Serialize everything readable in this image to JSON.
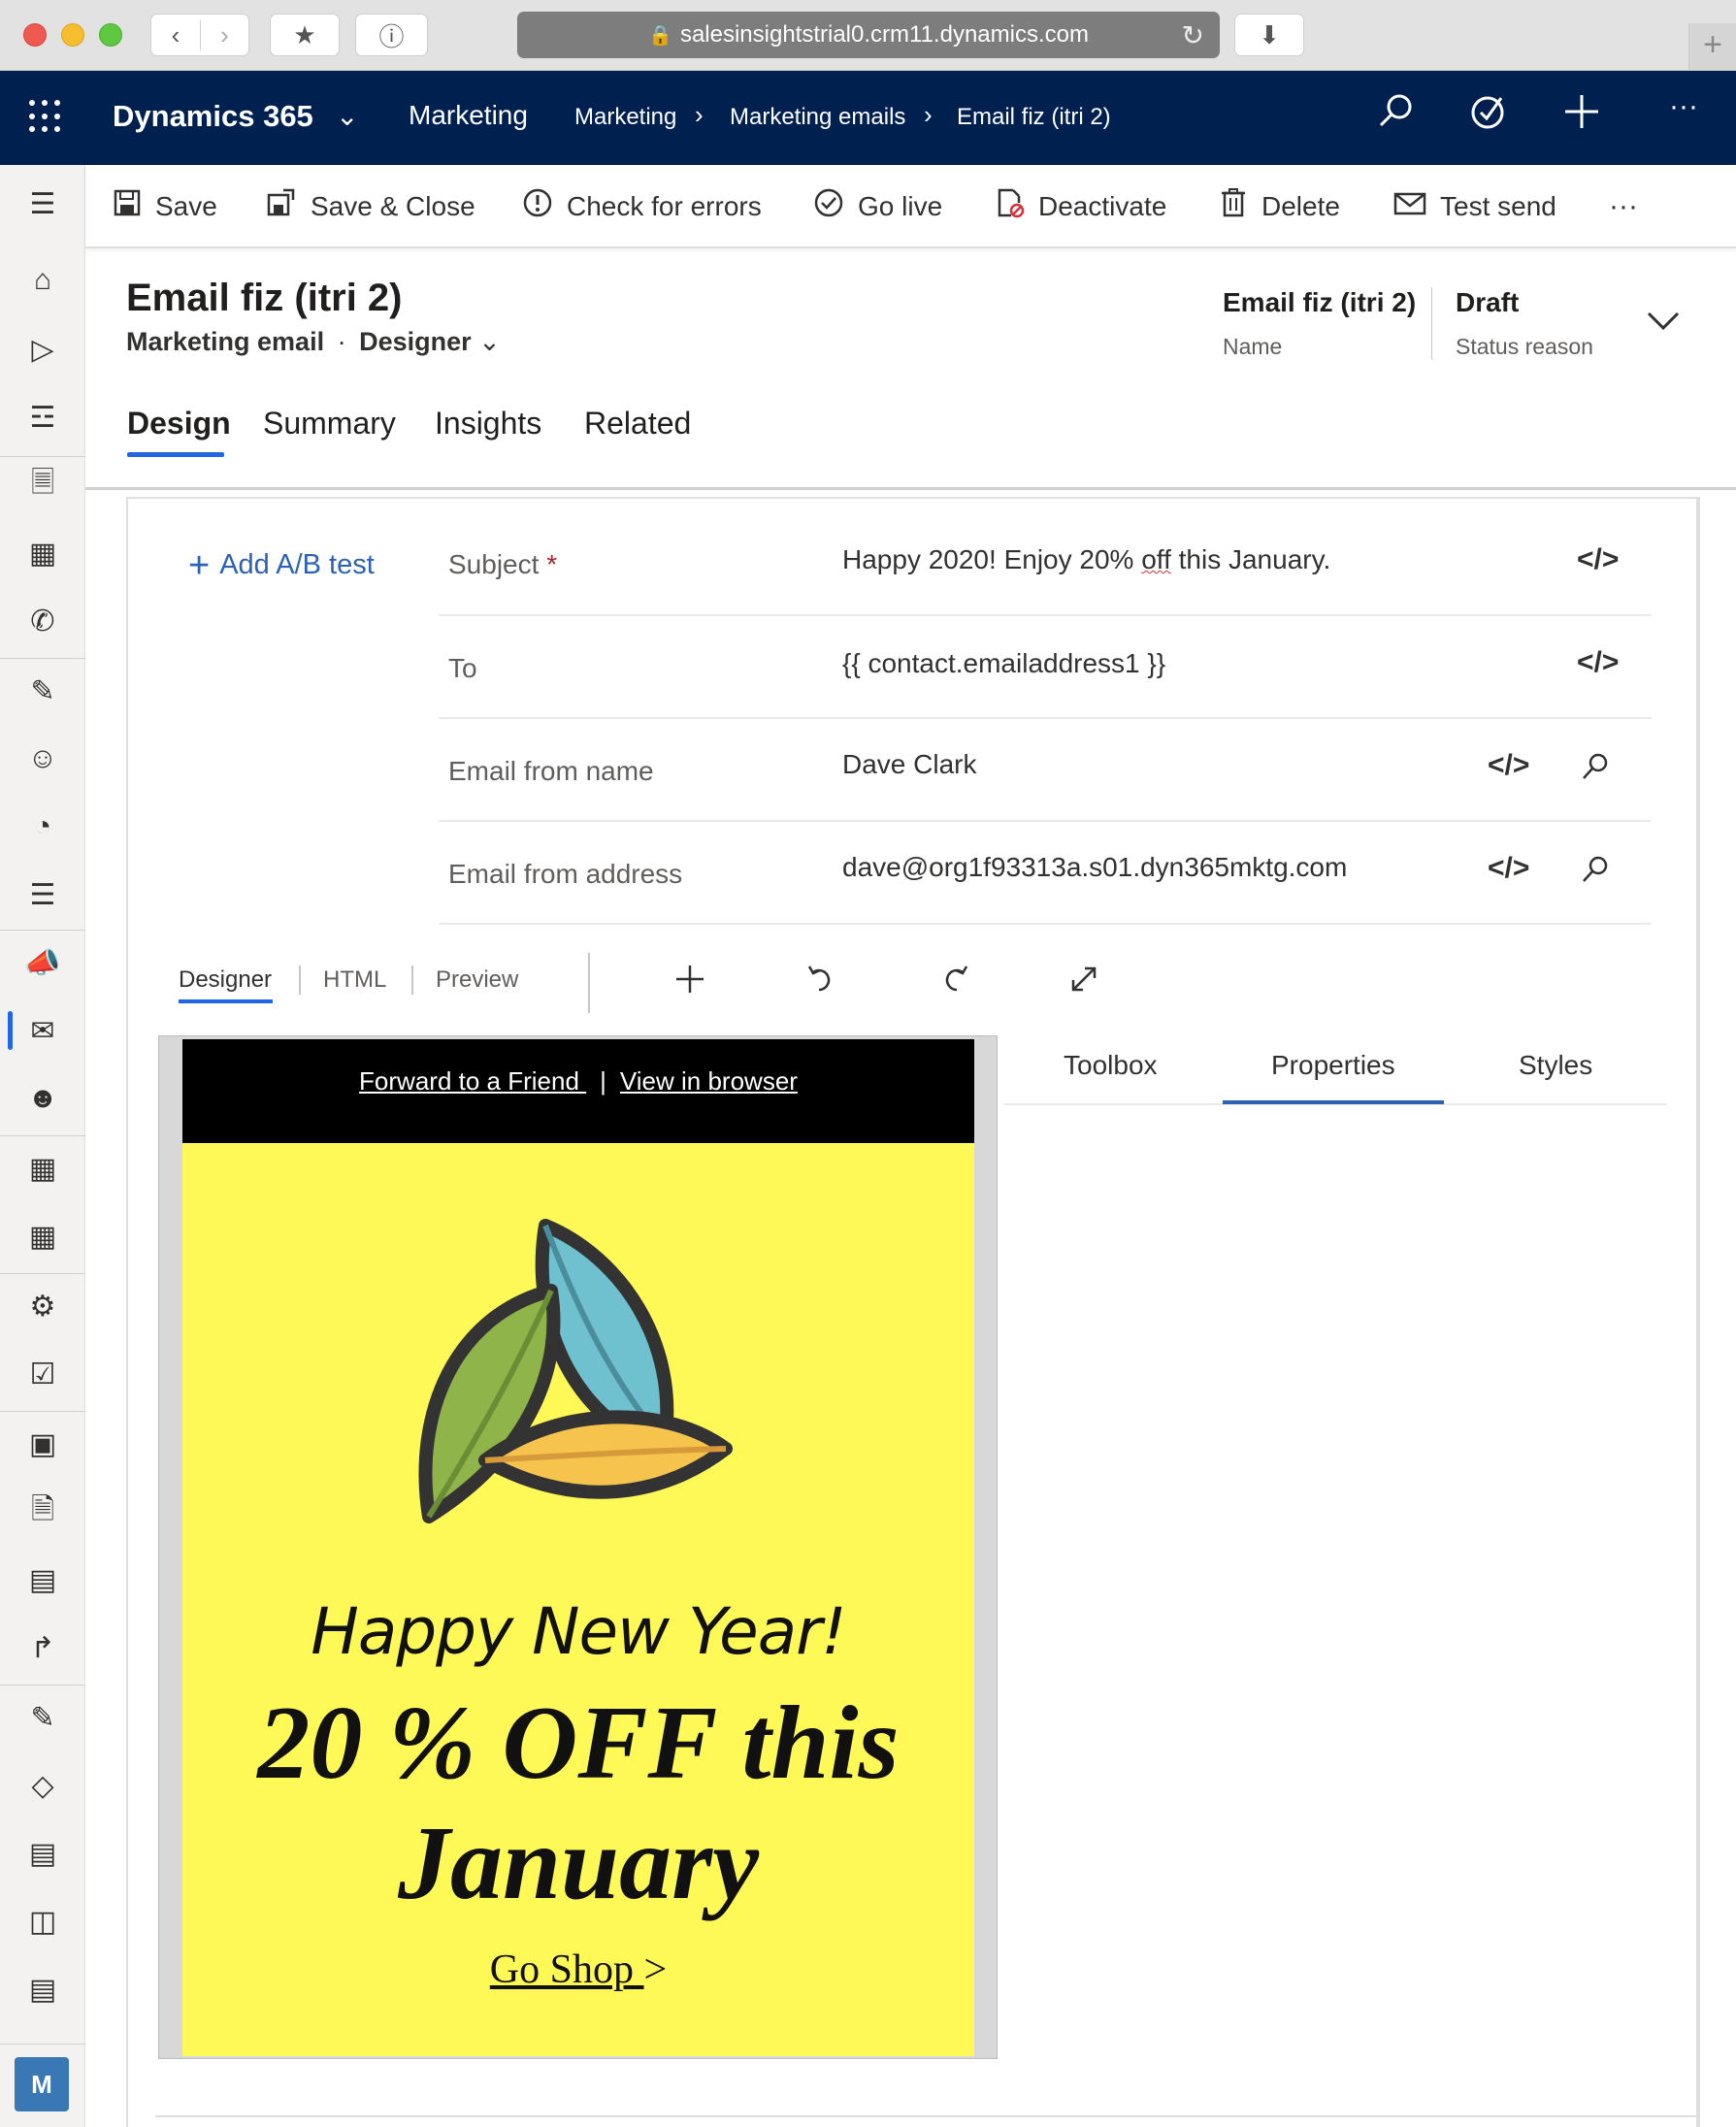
{
  "browser": {
    "url": "salesinsightstrial0.crm11.dynamics.com",
    "back_icon": "chevron-left-icon",
    "forward_icon": "chevron-right-icon"
  },
  "topnav": {
    "app_name": "Dynamics 365",
    "area": "Marketing",
    "breadcrumb": [
      "Marketing",
      "Marketing emails",
      "Email fiz (itri 2)"
    ],
    "background": "#002050"
  },
  "commands": {
    "save": "Save",
    "save_close": "Save & Close",
    "check_errors": "Check for errors",
    "go_live": "Go live",
    "deactivate": "Deactivate",
    "delete": "Delete",
    "test_send": "Test send",
    "more": "···"
  },
  "record": {
    "title": "Email fiz (itri 2)",
    "entity": "Marketing email",
    "form": "Designer",
    "header_fields": [
      {
        "value": "Email fiz (itri 2)",
        "label": "Name"
      },
      {
        "value": "Draft",
        "label": "Status reason"
      }
    ]
  },
  "tabs": [
    "Design",
    "Summary",
    "Insights",
    "Related"
  ],
  "form": {
    "add_ab": "Add A/B test",
    "subject_label": "Subject",
    "required_mark": "*",
    "subject_before": "Happy 2020! Enjoy 20% ",
    "subject_squiggle": "off",
    "subject_after": " this January.",
    "to_label": "To",
    "to_value": "{{ contact.emailaddress1 }}",
    "from_name_label": "Email from name",
    "from_name_value": "Dave Clark",
    "from_address_label": "Email from address",
    "from_address_value": "dave@org1f93313a.s01.dyn365mktg.com",
    "code_icon": "</>"
  },
  "editor": {
    "tabs": [
      "Designer",
      "HTML",
      "Preview"
    ],
    "side_tabs": [
      "Toolbox",
      "Properties",
      "Styles"
    ]
  },
  "email": {
    "forward_link": "Forward to a Friend ",
    "pipe": "|",
    "browser_link": "View in browser",
    "headline": "Happy New Year!",
    "offer_line1": "20 % OFF this",
    "offer_line2": "January",
    "cta": "Go Shop ",
    "cta_arrow": ">",
    "body_color": "#fff957"
  },
  "user": {
    "initial": "M"
  },
  "accent": "#2266e3"
}
